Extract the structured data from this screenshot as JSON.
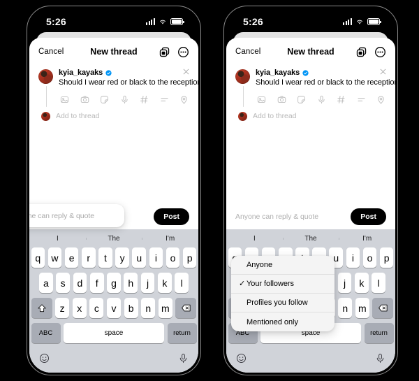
{
  "status_bar": {
    "time": "5:26",
    "icons": [
      "cellular-signal-icon",
      "wifi-icon",
      "battery-icon"
    ]
  },
  "nav": {
    "cancel_label": "Cancel",
    "title": "New thread",
    "icons": [
      "copy-stack-icon",
      "more-circle-icon"
    ]
  },
  "composer": {
    "username": "kyia_kayaks",
    "verified": true,
    "text": "Should I wear red or black to the reception?",
    "close_icon": "close-icon",
    "tools": [
      "image-icon",
      "camera-icon",
      "sticker-icon",
      "microphone-icon",
      "hashtag-icon",
      "poll-icon",
      "location-icon"
    ],
    "add_to_thread_label": "Add to thread"
  },
  "bottom_bar": {
    "reply_setting_label": "Anyone can reply & quote",
    "post_label": "Post"
  },
  "audience_menu": {
    "items": [
      {
        "label": "Anyone",
        "checked": false
      },
      {
        "label": "Your followers",
        "checked": true
      },
      {
        "label": "Profiles you follow",
        "checked": false
      },
      {
        "label": "Mentioned only",
        "checked": false
      }
    ],
    "check_glyph": "✓"
  },
  "keyboard": {
    "predictions": [
      "I",
      "The",
      "I'm"
    ],
    "row1": [
      "q",
      "w",
      "e",
      "r",
      "t",
      "y",
      "u",
      "i",
      "o",
      "p"
    ],
    "row2": [
      "a",
      "s",
      "d",
      "f",
      "g",
      "h",
      "j",
      "k",
      "l"
    ],
    "row3": [
      "z",
      "x",
      "c",
      "v",
      "b",
      "n",
      "m"
    ],
    "shift_icon": "shift-icon",
    "backspace_icon": "backspace-icon",
    "abc_label": "ABC",
    "space_label": "space",
    "return_label": "return",
    "emoji_icon": "emoji-icon",
    "dictation_icon": "microphone-icon"
  },
  "colors": {
    "verified_blue": "#0095f6",
    "post_button_bg": "#000000",
    "keyboard_bg": "#d0d3d9",
    "key_bg": "#ffffff",
    "fn_key_bg": "#a8acb5",
    "placeholder_gray": "#b0b0b0"
  }
}
